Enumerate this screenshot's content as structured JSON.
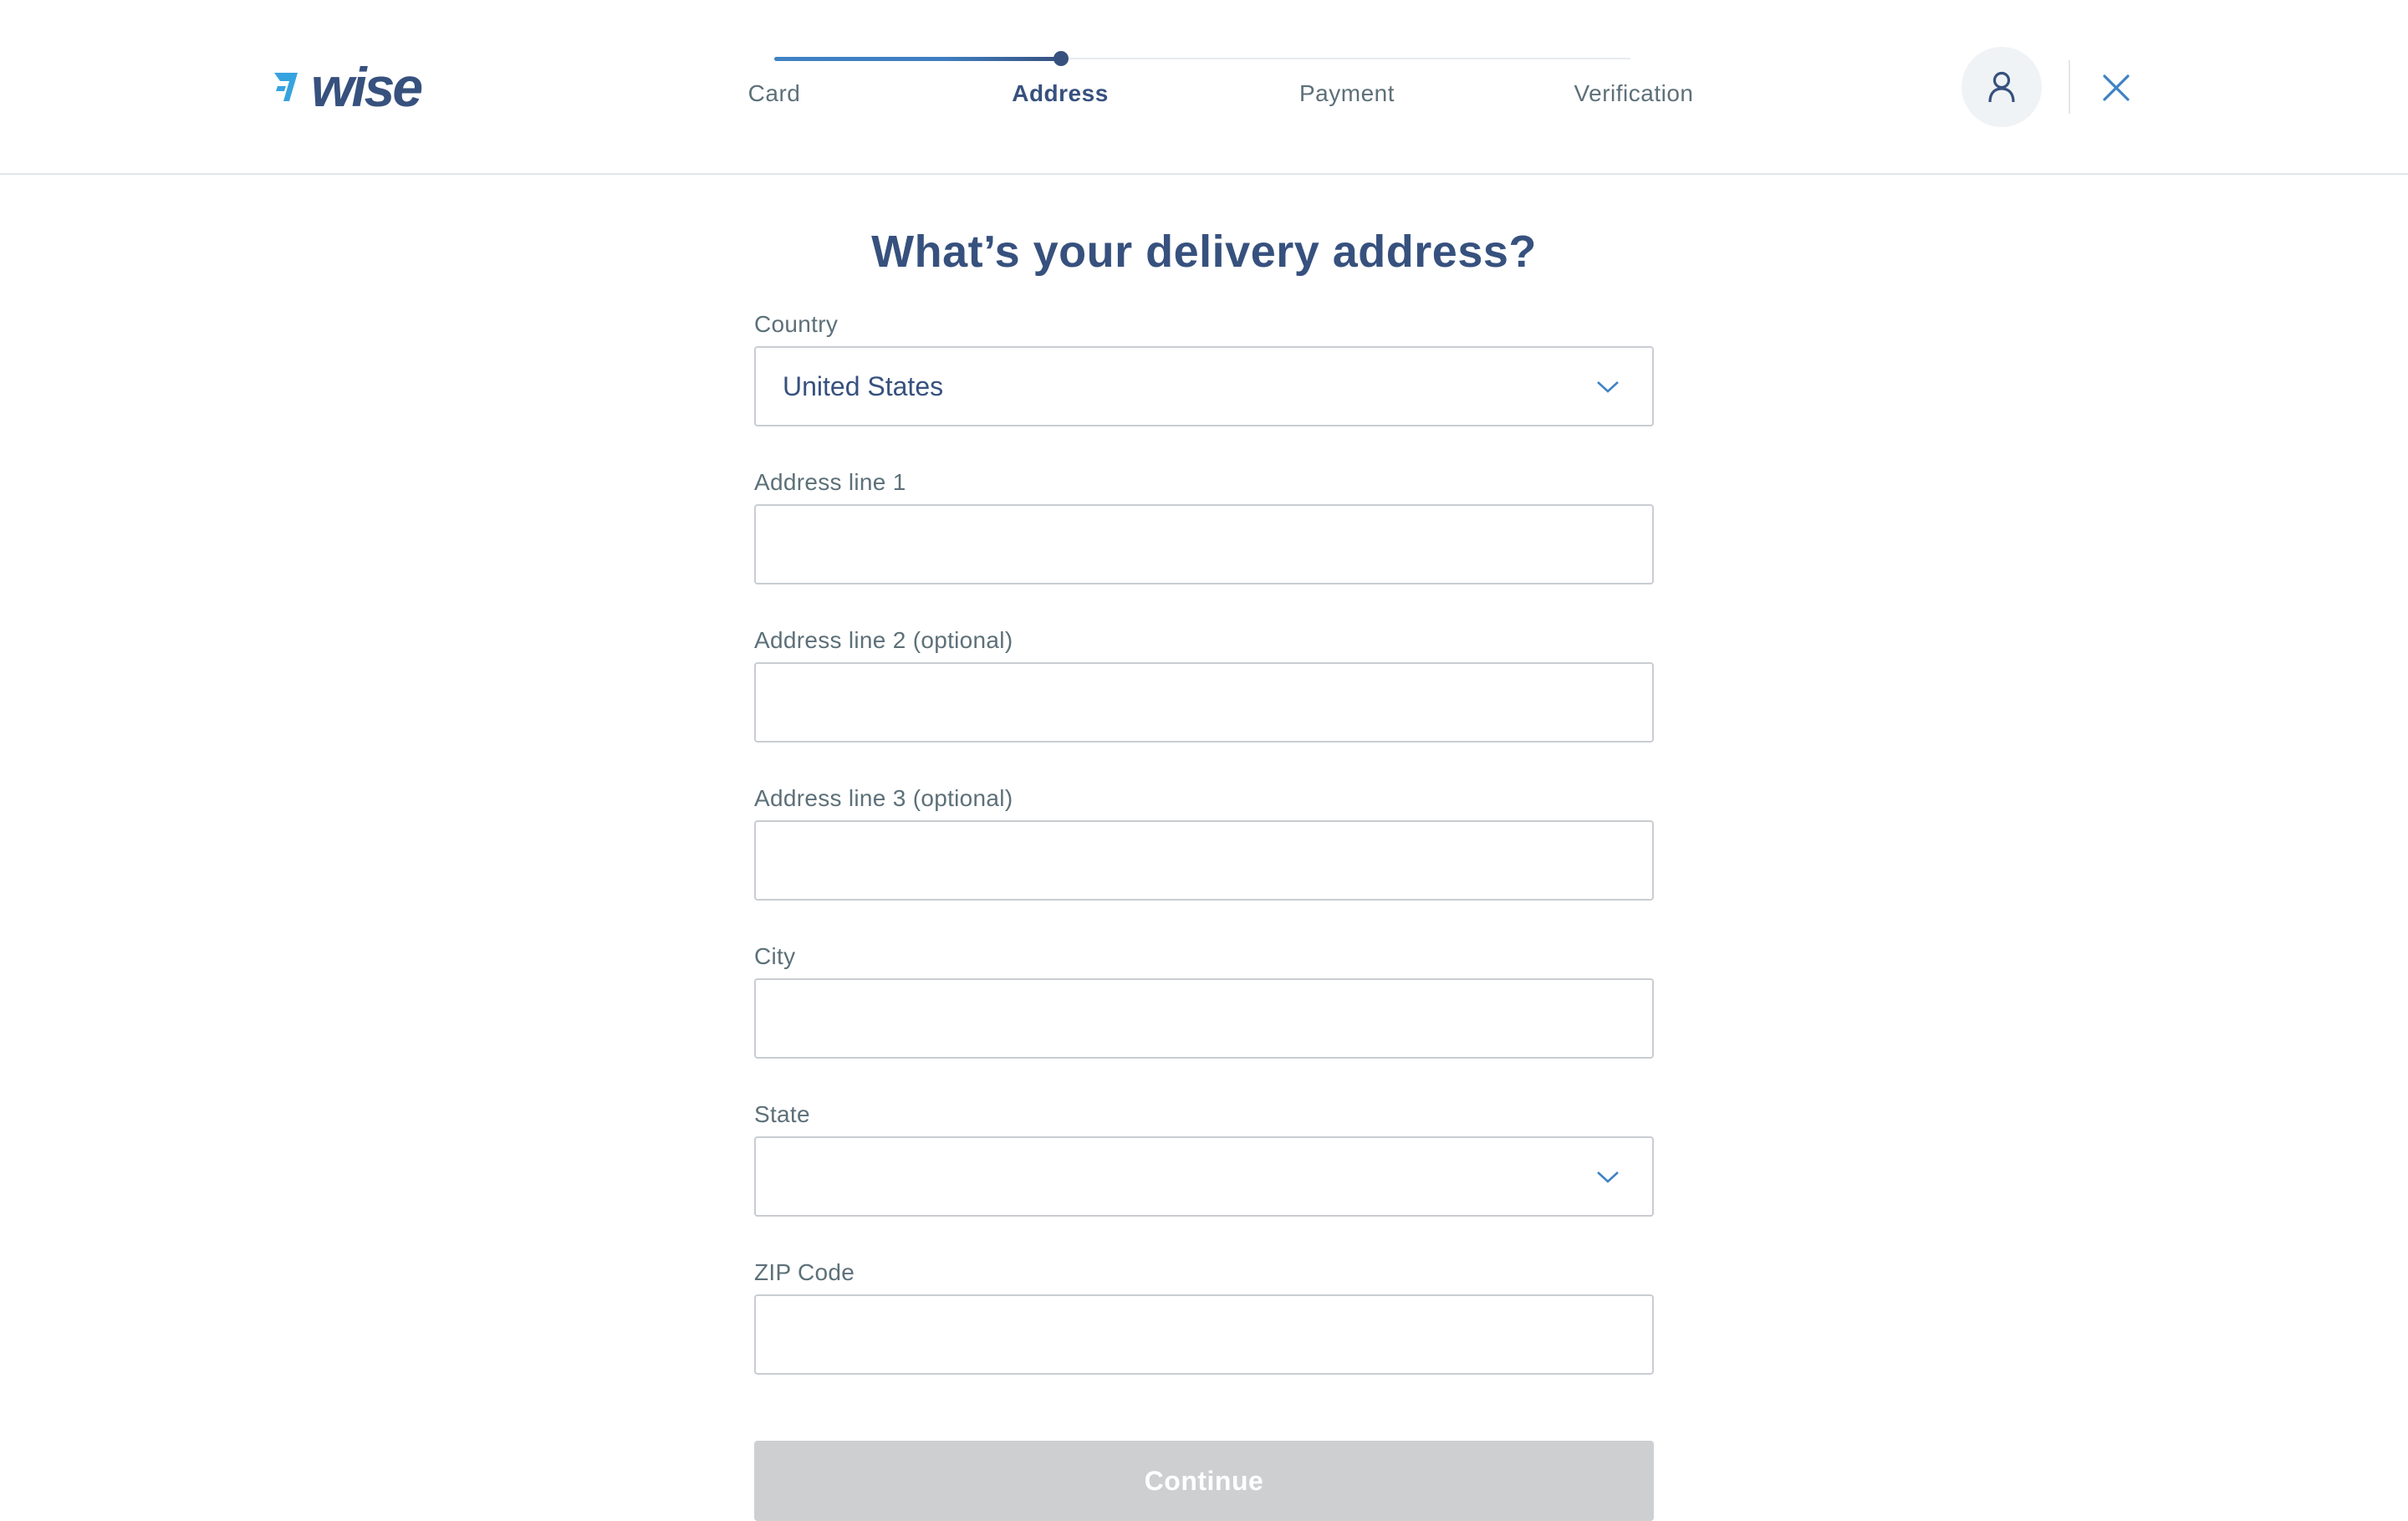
{
  "brand": {
    "name": "wise",
    "color": "#37517e",
    "accent": "#3f82c4"
  },
  "stepper": {
    "steps": [
      {
        "label": "Card"
      },
      {
        "label": "Address"
      },
      {
        "label": "Payment"
      },
      {
        "label": "Verification"
      }
    ],
    "active_index": 1
  },
  "header": {
    "profile_icon": "user-icon",
    "close_icon": "close-icon"
  },
  "form": {
    "title": "What’s your delivery address?",
    "fields": {
      "country": {
        "label": "Country",
        "value": "United States"
      },
      "address1": {
        "label": "Address line 1",
        "value": ""
      },
      "address2": {
        "label": "Address line 2 (optional)",
        "value": ""
      },
      "address3": {
        "label": "Address line 3 (optional)",
        "value": ""
      },
      "city": {
        "label": "City",
        "value": ""
      },
      "state": {
        "label": "State",
        "value": ""
      },
      "zip": {
        "label": "ZIP Code",
        "value": ""
      }
    },
    "continue_label": "Continue"
  }
}
